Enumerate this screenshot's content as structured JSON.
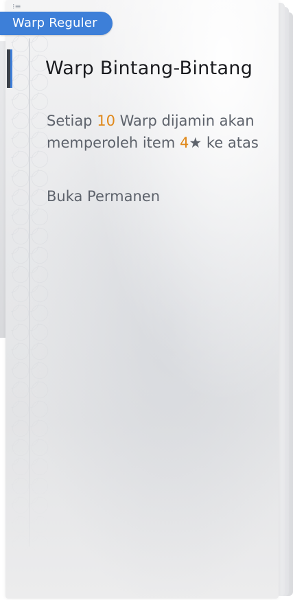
{
  "tag": {
    "label": "Warp Reguler"
  },
  "icons": {
    "list": "list-icon",
    "star": "star-icon"
  },
  "title": "Warp Bintang-Bintang",
  "description": {
    "part1": "Setiap ",
    "count": "10",
    "part2": " Warp dijamin akan memperoleh item ",
    "rarity": "4",
    "star": "★",
    "part3": " ke atas"
  },
  "status": "Buka Permanen",
  "colors": {
    "tag_bg": "#3d7fd8",
    "highlight": "#e0891b",
    "text": "#5d626b",
    "title": "#1a1b1f"
  }
}
